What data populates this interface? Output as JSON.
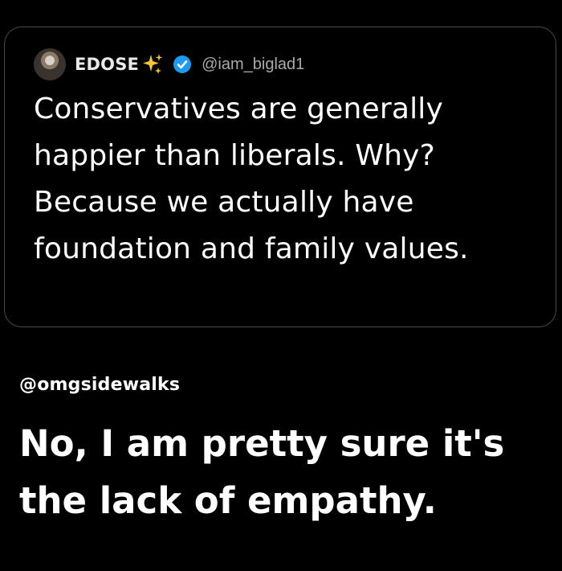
{
  "quoted_tweet": {
    "display_name": "EDOSE",
    "handle": "@iam_biglad1",
    "text": "Conservatives are generally happier than liberals. Why? Because we actually have foundation and family values.",
    "icons": {
      "avatar": "profile-photo",
      "sparkle": "sparkles-emoji",
      "verified": "verified-badge"
    },
    "colors": {
      "sparkle": "#f7c62f",
      "verified": "#1d9bf0",
      "border": "#4a4a4a"
    }
  },
  "reply": {
    "handle": "@omgsidewalks",
    "text": "No, I am pretty sure it's the lack of empathy."
  }
}
